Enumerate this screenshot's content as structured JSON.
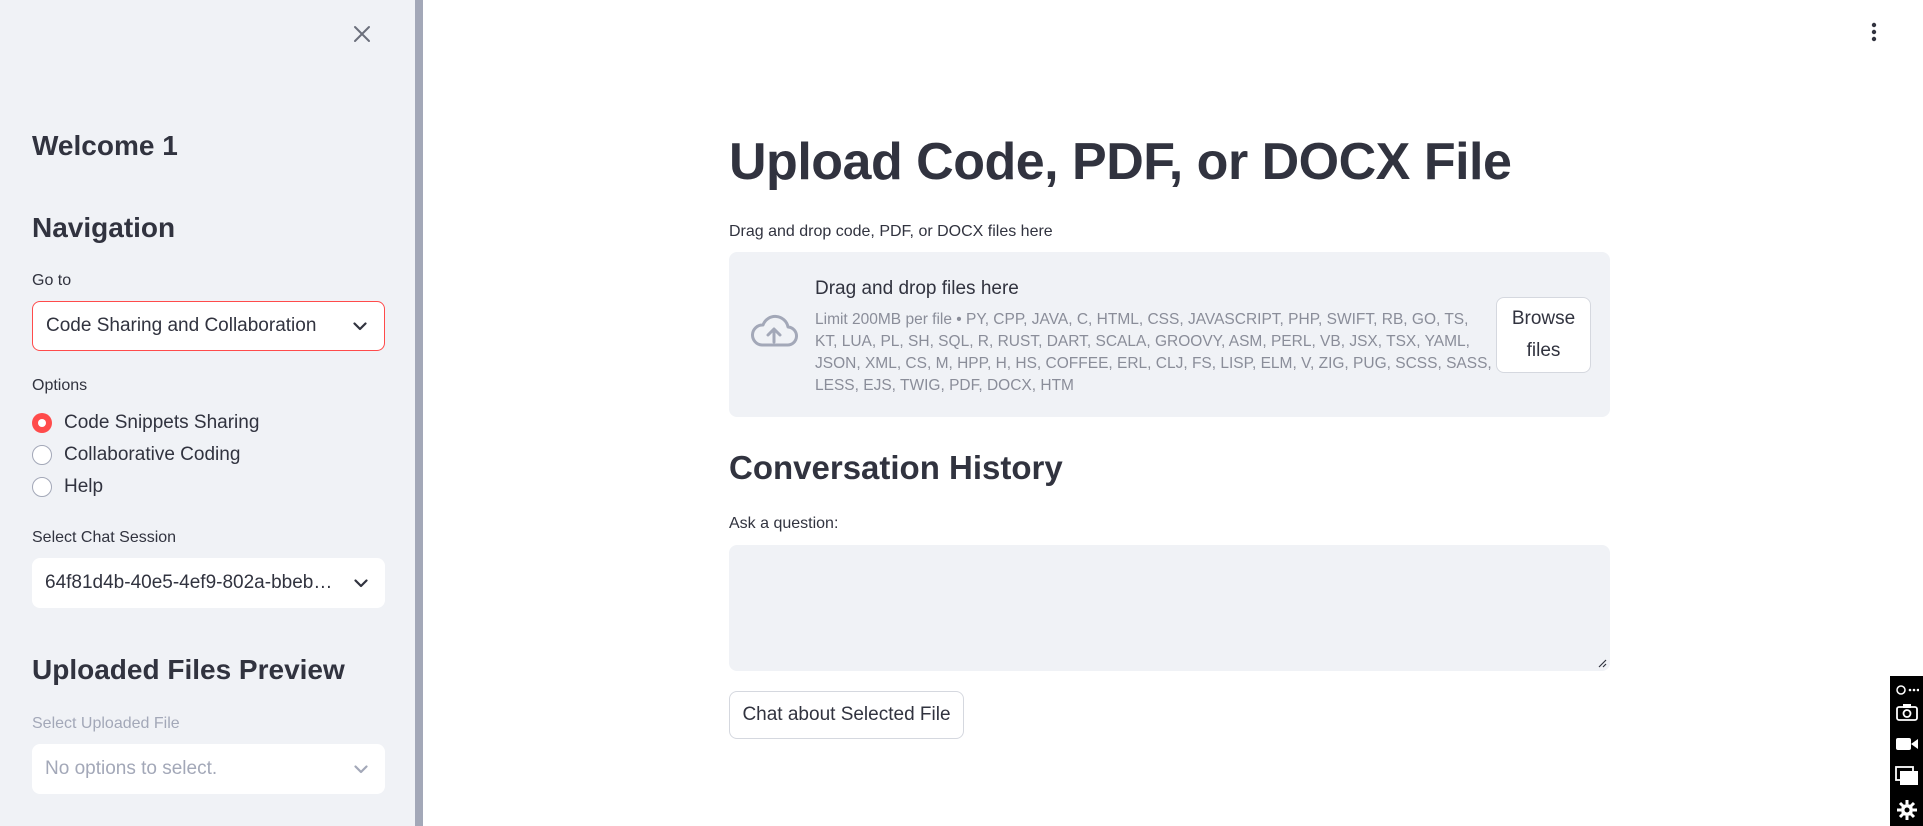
{
  "sidebar": {
    "welcome": "Welcome 1",
    "navigation_heading": "Navigation",
    "goto_label": "Go to",
    "goto_value": "Code Sharing and Collaboration",
    "options_label": "Options",
    "options": [
      {
        "label": "Code Snippets Sharing",
        "selected": true
      },
      {
        "label": "Collaborative Coding",
        "selected": false
      },
      {
        "label": "Help",
        "selected": false
      }
    ],
    "session_label": "Select Chat Session",
    "session_value": "64f81d4b-40e5-4ef9-802a-bbeb…",
    "uploaded_heading": "Uploaded Files Preview",
    "uploaded_label": "Select Uploaded File",
    "uploaded_placeholder": "No options to select."
  },
  "main": {
    "title": "Upload Code, PDF, or DOCX File",
    "uploader_caption": "Drag and drop code, PDF, or DOCX files here",
    "dropzone_title": "Drag and drop files here",
    "dropzone_limit": "Limit 200MB per file • PY, CPP, JAVA, C, HTML, CSS, JAVASCRIPT, PHP, SWIFT, RB, GO, TS, KT, LUA, PL, SH, SQL, R, RUST, DART, SCALA, GROOVY, ASM, PERL, VB, JSX, TSX, YAML, JSON, XML, CS, M, HPP, H, HS, COFFEE, ERL, CLJ, FS, LISP, ELM, V, ZIG, PUG, SCSS, SASS, LESS, EJS, TWIG, PDF, DOCX, HTM",
    "browse_label": "Browse files",
    "conversation_heading": "Conversation History",
    "question_label": "Ask a question:",
    "question_value": "",
    "chat_button": "Chat about Selected File"
  },
  "colors": {
    "accent": "#ff4b4b",
    "sidebar_bg": "#f0f2f6",
    "text": "#31333f",
    "muted": "#a3a8b8"
  },
  "icons": {
    "close": "close-icon",
    "chevron": "chevron-down-icon",
    "upload": "cloud-upload-icon",
    "menu": "kebab-menu-icon"
  }
}
